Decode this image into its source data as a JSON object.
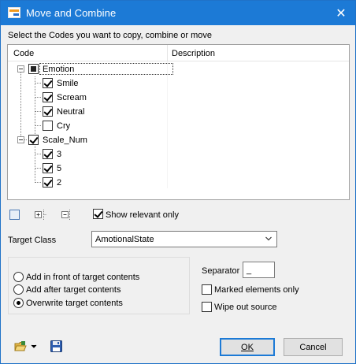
{
  "window": {
    "title": "Move and Combine",
    "close_glyph": "✕"
  },
  "instruction": "Select the Codes you want to copy, combine or move",
  "tree": {
    "columns": [
      "Code",
      "Description"
    ],
    "nodes": [
      {
        "label": "Emotion",
        "state": "indeterminate"
      },
      {
        "label": "Smile",
        "state": "checked"
      },
      {
        "label": "Scream",
        "state": "checked"
      },
      {
        "label": "Neutral",
        "state": "checked"
      },
      {
        "label": "Cry",
        "state": "unchecked"
      },
      {
        "label": "Scale_Num",
        "state": "checked"
      },
      {
        "label": "3",
        "state": "checked"
      },
      {
        "label": "5",
        "state": "checked"
      },
      {
        "label": "2",
        "state": "checked"
      }
    ]
  },
  "toolbar": {
    "select_icon": "checkbox-square-icon",
    "expand_icon": "expand-all-icon",
    "collapse_icon": "collapse-all-icon",
    "show_relevant_label": "Show relevant only",
    "show_relevant_checked": true
  },
  "target_class": {
    "label": "Target Class",
    "value": "AmotionalState"
  },
  "placement": {
    "options": [
      "Add in front of target contents",
      "Add after target contents",
      "Overwrite target contents"
    ],
    "selected": "Overwrite target contents"
  },
  "separator": {
    "label": "Separator",
    "value": "_"
  },
  "marked_only": {
    "label": "Marked elements only",
    "checked": false
  },
  "wipe_source": {
    "label": "Wipe out source",
    "checked": false
  },
  "footer": {
    "folder_icon": "open-folder-icon",
    "save_icon": "save-disk-icon",
    "ok_label": "OK",
    "cancel_label": "Cancel"
  },
  "colors": {
    "titlebar": "#1c7ad6",
    "accent": "#1c7ad6"
  }
}
